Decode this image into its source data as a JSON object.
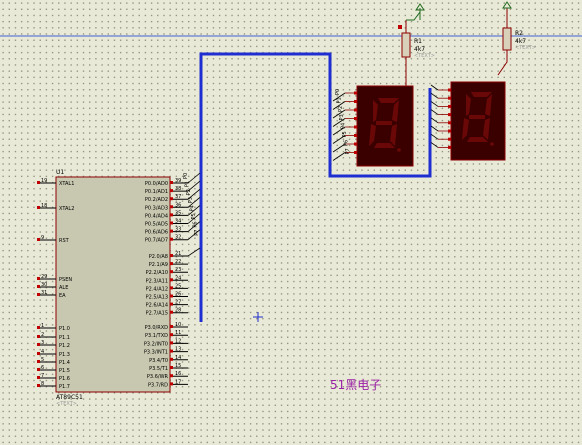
{
  "schematic": {
    "mcu": {
      "ref": "U1",
      "part": "AT89C51",
      "text_tag": "<TEXT>",
      "left_pins": [
        {
          "num": "19",
          "name": "XTAL1"
        },
        {
          "num": "18",
          "name": "XTAL2"
        },
        {
          "num": "9",
          "name": "RST"
        },
        {
          "num": "29",
          "name": "PSEN"
        },
        {
          "num": "30",
          "name": "ALE"
        },
        {
          "num": "31",
          "name": "EA"
        },
        {
          "num": "1",
          "name": "P1.0"
        },
        {
          "num": "2",
          "name": "P1.1"
        },
        {
          "num": "3",
          "name": "P1.2"
        },
        {
          "num": "4",
          "name": "P1.3"
        },
        {
          "num": "5",
          "name": "P1.4"
        },
        {
          "num": "6",
          "name": "P1.5"
        },
        {
          "num": "7",
          "name": "P1.6"
        },
        {
          "num": "8",
          "name": "P1.7"
        }
      ],
      "right_pins": [
        {
          "num": "39",
          "name": "P0.0/AD0"
        },
        {
          "num": "38",
          "name": "P0.1/AD1"
        },
        {
          "num": "37",
          "name": "P0.2/AD2"
        },
        {
          "num": "36",
          "name": "P0.3/AD3"
        },
        {
          "num": "35",
          "name": "P0.4/AD4"
        },
        {
          "num": "34",
          "name": "P0.5/AD5"
        },
        {
          "num": "33",
          "name": "P0.6/AD6"
        },
        {
          "num": "32",
          "name": "P0.7/AD7"
        },
        {
          "num": "21",
          "name": "P2.0/A8"
        },
        {
          "num": "22",
          "name": "P2.1/A9"
        },
        {
          "num": "23",
          "name": "P2.2/A10"
        },
        {
          "num": "24",
          "name": "P2.3/A11"
        },
        {
          "num": "25",
          "name": "P2.4/A12"
        },
        {
          "num": "26",
          "name": "P2.5/A13"
        },
        {
          "num": "27",
          "name": "P2.6/A14"
        },
        {
          "num": "28",
          "name": "P2.7/A15"
        },
        {
          "num": "10",
          "name": "P3.0/RXD"
        },
        {
          "num": "11",
          "name": "P3.1/TXD"
        },
        {
          "num": "12",
          "name": "P3.2/INT0"
        },
        {
          "num": "13",
          "name": "P3.3/INT1"
        },
        {
          "num": "14",
          "name": "P3.4/T0"
        },
        {
          "num": "15",
          "name": "P3.5/T1"
        },
        {
          "num": "16",
          "name": "P3.6/WR"
        },
        {
          "num": "17",
          "name": "P3.7/RD"
        }
      ],
      "bus_labels": [
        "P0",
        "P1",
        "P2",
        "P3",
        "P4",
        "P5",
        "P6",
        "P7"
      ]
    },
    "resistors": [
      {
        "ref": "R1",
        "value": "4k7",
        "text_tag": "<TEXT>"
      },
      {
        "ref": "R2",
        "value": "4k7",
        "text_tag": "<TEXT>"
      }
    ],
    "display1_labels": [
      "P0",
      "P1",
      "P2",
      "P3",
      "P4",
      "P5",
      "P6",
      "P7"
    ],
    "watermark": "51黑电子"
  },
  "colors": {
    "background": "#e9e9d7",
    "wire_bus": "#1f2ed0",
    "component_body": "#c8c8b0",
    "component_outline": "#8b0000",
    "pin_marker": "#c00000",
    "display_body": "#3a0000",
    "display_segment": "#6a0808",
    "rail": "#4060d0",
    "power_arrow": "#1f6b1f",
    "watermark": "#9a1fa6"
  }
}
